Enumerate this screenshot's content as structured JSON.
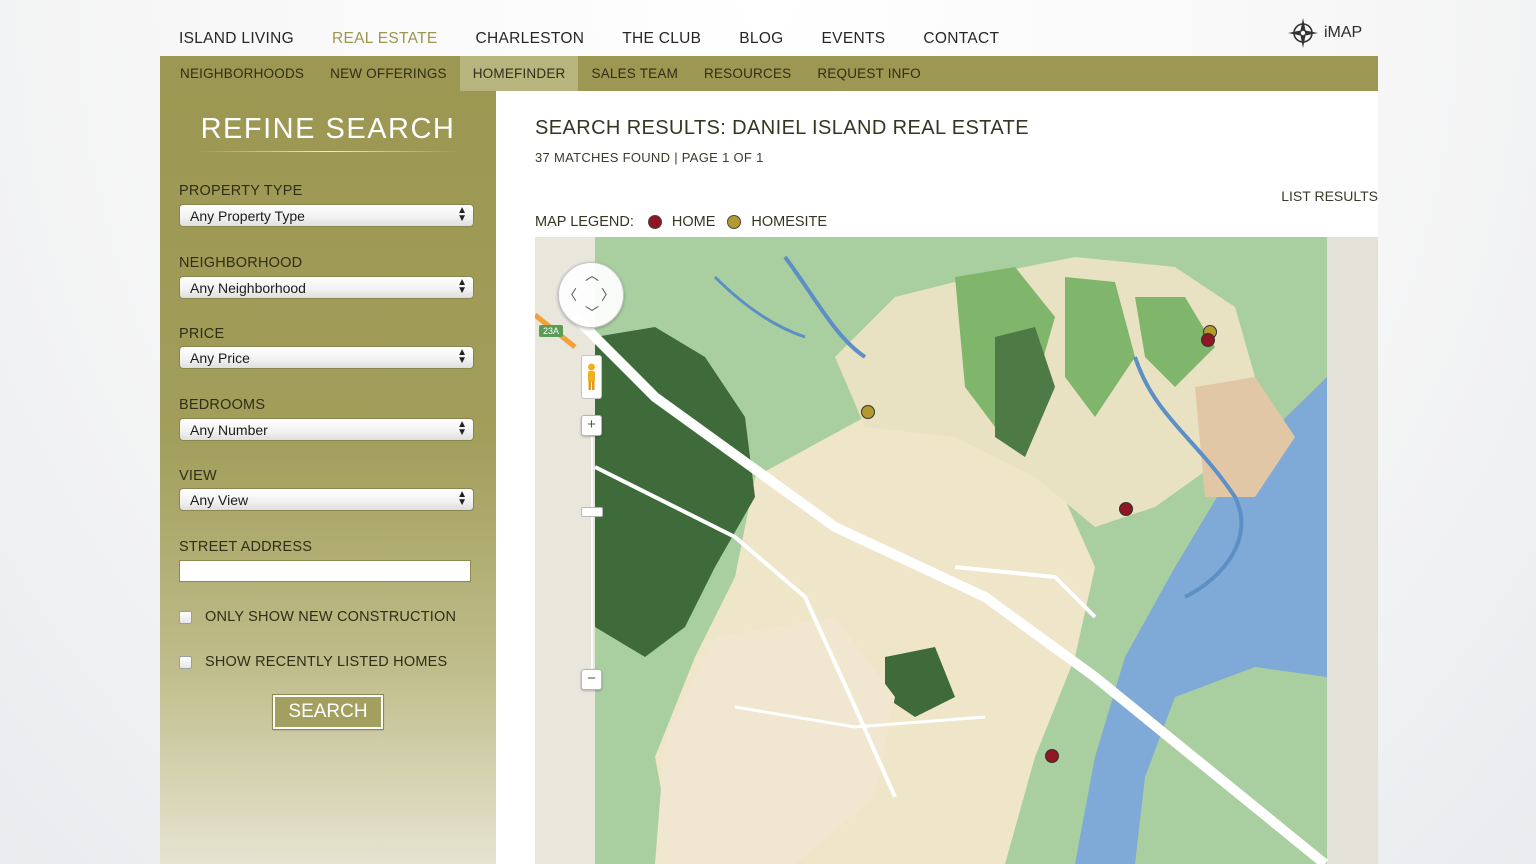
{
  "top_nav": {
    "items": [
      {
        "label": "ISLAND LIVING",
        "active": false
      },
      {
        "label": "REAL ESTATE",
        "active": true
      },
      {
        "label": "CHARLESTON",
        "active": false
      },
      {
        "label": "THE CLUB",
        "active": false
      },
      {
        "label": "BLOG",
        "active": false
      },
      {
        "label": "EVENTS",
        "active": false
      },
      {
        "label": "CONTACT",
        "active": false
      }
    ],
    "imap_label": "iMAP",
    "imap_icon": "compass-icon"
  },
  "sub_nav": {
    "items": [
      {
        "label": "NEIGHBORHOODS",
        "active": false
      },
      {
        "label": "NEW OFFERINGS",
        "active": false
      },
      {
        "label": "HOMEFINDER",
        "active": true
      },
      {
        "label": "SALES TEAM",
        "active": false
      },
      {
        "label": "RESOURCES",
        "active": false
      },
      {
        "label": "REQUEST INFO",
        "active": false
      }
    ]
  },
  "sidebar": {
    "title": "REFINE SEARCH",
    "fields": {
      "property_type": {
        "label": "PROPERTY TYPE",
        "value": "Any Property Type"
      },
      "neighborhood": {
        "label": "NEIGHBORHOOD",
        "value": "Any Neighborhood"
      },
      "price": {
        "label": "PRICE",
        "value": "Any Price"
      },
      "bedrooms": {
        "label": "BEDROOMS",
        "value": "Any Number"
      },
      "view": {
        "label": "VIEW",
        "value": "Any View"
      }
    },
    "street_address": {
      "label": "STREET ADDRESS",
      "value": ""
    },
    "checkboxes": {
      "new_construction": {
        "label": "ONLY SHOW NEW CONSTRUCTION",
        "checked": false
      },
      "recently_listed": {
        "label": "SHOW RECENTLY LISTED HOMES",
        "checked": false
      }
    },
    "search_label": "SEARCH"
  },
  "results": {
    "title": "SEARCH RESULTS: DANIEL ISLAND REAL ESTATE",
    "meta": "37 MATCHES FOUND | PAGE 1 OF 1",
    "list_results_label": "LIST RESULTS"
  },
  "legend": {
    "title": "MAP LEGEND:",
    "items": [
      {
        "label": "HOME",
        "color": "#8f1622"
      },
      {
        "label": "HOMESITE",
        "color": "#b39a2e"
      }
    ]
  },
  "map": {
    "route_shield": "23A",
    "zoom_in": "+",
    "zoom_out": "−",
    "colors": {
      "water": "#7fa9d6",
      "marsh": "#a9cfa0",
      "land": "#efe5c8",
      "forest": "#3f6b3a",
      "golf": "#7fb66c",
      "road": "#ffffff"
    }
  },
  "colors": {
    "olive": "#9c9752",
    "olive_light": "#b8b47d",
    "active_text": "#9b9650"
  }
}
